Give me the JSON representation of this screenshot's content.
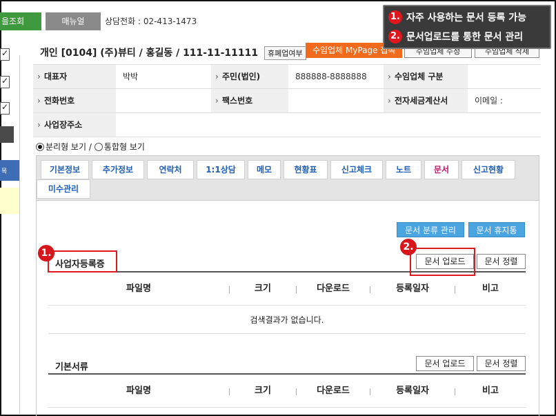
{
  "topbar": {
    "lookup_label": "을조회",
    "manual_label": "매뉴얼",
    "phone_text": "상담전화 : 02-413-1473"
  },
  "callout": {
    "items": [
      {
        "num": "1.",
        "text": "자주 사용하는 문서 등록 가능"
      },
      {
        "num": "2.",
        "text": "문서업로드를 통한 문서 관리"
      }
    ]
  },
  "left_strip": {
    "blue_label": "목"
  },
  "company": {
    "title": "개인 [0104] (주)뷰티 / 홍길동 / 111-11-11111",
    "closure_tag": "휴폐업여부",
    "mypage_button": "수임업체 MyPage 접속",
    "edit_button": "수임업체 수정",
    "delete_button": "수임업체 삭제"
  },
  "info": {
    "rows": [
      [
        {
          "label": "대표자",
          "value": "박박"
        },
        {
          "label": "주민(법인)",
          "value": "888888-8888888"
        },
        {
          "label": "수임업체 구분",
          "value": ""
        }
      ],
      [
        {
          "label": "전화번호",
          "value": ""
        },
        {
          "label": "팩스번호",
          "value": ""
        },
        {
          "label": "전자세금계산서",
          "value": "이메일 :"
        }
      ],
      [
        {
          "label": "사업장주소",
          "value": ""
        }
      ]
    ]
  },
  "view_mode": {
    "options": [
      "분리형 보기 /",
      "통합형 보기"
    ],
    "selected": 0
  },
  "tabs": {
    "row1": [
      "기본정보",
      "추가정보",
      "연락처",
      "1:1상담",
      "메모",
      "현황표",
      "신고체크",
      "노트",
      "문서",
      "신고현황"
    ],
    "row2": [
      "미수관리"
    ],
    "active": "문서"
  },
  "docs": {
    "category_button": "문서 분류 관리",
    "trash_button": "문서 휴지통",
    "upload_label": "문서 업로드",
    "sort_label": "문서 정렬",
    "columns": [
      "파일명",
      "크기",
      "다운로드",
      "등록일자",
      "비고"
    ],
    "sections": [
      {
        "title": "사업자등록증",
        "empty_message": "검색결과가 없습니다."
      },
      {
        "title": "기본서류"
      }
    ]
  },
  "markers": [
    "1.",
    "2."
  ],
  "colors": {
    "accent_red": "#e0181e",
    "tab_blue": "#1f5fb5",
    "tab_active": "#c0136a",
    "orange": "#f26b1d",
    "green": "#3f9a3f",
    "sky": "#4aa4e0"
  }
}
